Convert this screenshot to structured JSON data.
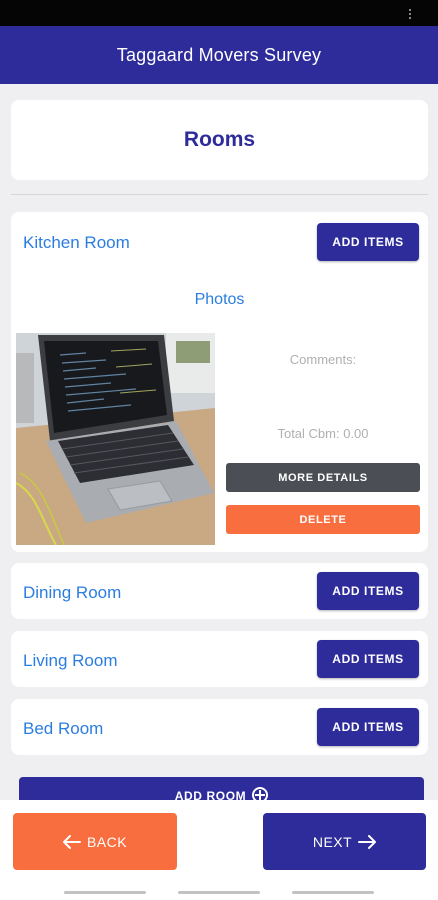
{
  "app": {
    "title": "Taggaard Movers Survey"
  },
  "page": {
    "title": "Rooms"
  },
  "rooms": [
    {
      "name": "Kitchen Room",
      "add_items_label": "ADD ITEMS",
      "photos_label": "Photos",
      "comments_label": "Comments:",
      "total_cbm_label": "Total Cbm: 0.00",
      "more_details_label": "MORE DETAILS",
      "delete_label": "DELETE"
    },
    {
      "name": "Dining Room",
      "add_items_label": "ADD ITEMS"
    },
    {
      "name": "Living Room",
      "add_items_label": "ADD ITEMS"
    },
    {
      "name": "Bed Room",
      "add_items_label": "ADD ITEMS"
    }
  ],
  "add_room_label": "ADD ROOM",
  "footer": {
    "back_label": "BACK",
    "next_label": "NEXT"
  },
  "colors": {
    "primary": "#2e2b9b",
    "accent": "#f96e3f",
    "link": "#2b7de0",
    "dark_button": "#4c4e55"
  },
  "icons": {
    "add_room": "plus-circle-icon",
    "back": "arrow-left-icon",
    "next": "arrow-right-icon"
  }
}
